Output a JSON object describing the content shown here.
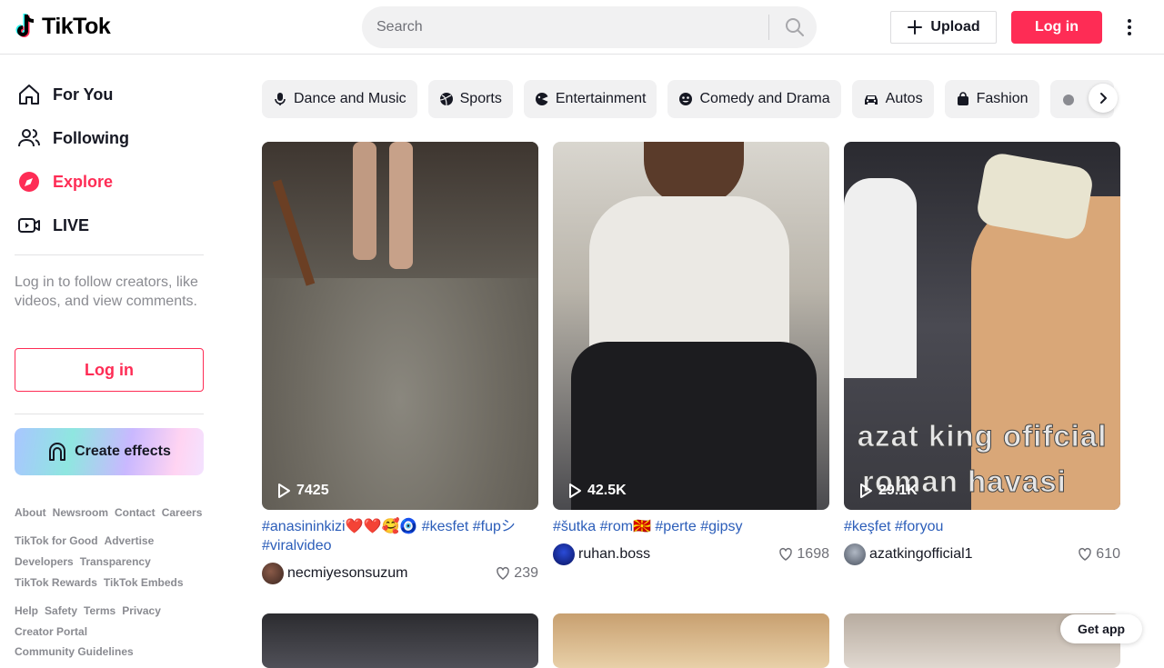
{
  "header": {
    "logo_text": "TikTok",
    "search_placeholder": "Search",
    "upload_label": "Upload",
    "login_label": "Log in"
  },
  "sidebar": {
    "items": [
      {
        "label": "For You",
        "icon": "home-icon"
      },
      {
        "label": "Following",
        "icon": "people-icon"
      },
      {
        "label": "Explore",
        "icon": "compass-icon",
        "active": true
      },
      {
        "label": "LIVE",
        "icon": "live-icon"
      }
    ],
    "login_prompt": "Log in to follow creators, like videos, and view comments.",
    "login_label": "Log in",
    "effects_label": "Create effects",
    "footer_rows": [
      [
        "About",
        "Newsroom",
        "Contact",
        "Careers"
      ],
      [
        "TikTok for Good",
        "Advertise"
      ],
      [
        "Developers",
        "Transparency"
      ],
      [
        "TikTok Rewards",
        "TikTok Embeds"
      ],
      [
        "Help",
        "Safety",
        "Terms",
        "Privacy"
      ],
      [
        "Creator Portal"
      ],
      [
        "Community Guidelines"
      ]
    ]
  },
  "categories": [
    {
      "label": "Dance and Music",
      "icon": "mic-icon"
    },
    {
      "label": "Sports",
      "icon": "ball-icon"
    },
    {
      "label": "Entertainment",
      "icon": "popcorn-icon"
    },
    {
      "label": "Comedy and Drama",
      "icon": "mask-icon"
    },
    {
      "label": "Autos",
      "icon": "car-icon"
    },
    {
      "label": "Fashion",
      "icon": "bag-icon"
    },
    {
      "label": "",
      "icon": "food-icon"
    }
  ],
  "videos": [
    {
      "plays": "7425",
      "caption": "#anasininkizi❤️❤️🥰🧿 #kesfet #fupシ #viralvideo",
      "user": "necmiyesonsuzum",
      "likes": "239"
    },
    {
      "plays": "42.5K",
      "caption": "#šutka #rom🇲🇰 #perte #gipsy",
      "user": "ruhan.boss",
      "likes": "1698"
    },
    {
      "plays": "29.1K",
      "caption": "#keşfet #foryou",
      "user": "azatkingofficial1",
      "likes": "610",
      "overlay_line1": "azat king ofifcial",
      "overlay_line2": "roman havasi"
    }
  ],
  "get_app_label": "Get app",
  "colors": {
    "brand": "#fe2c55",
    "link": "#2b5db9",
    "muted": "#8a8b91"
  }
}
